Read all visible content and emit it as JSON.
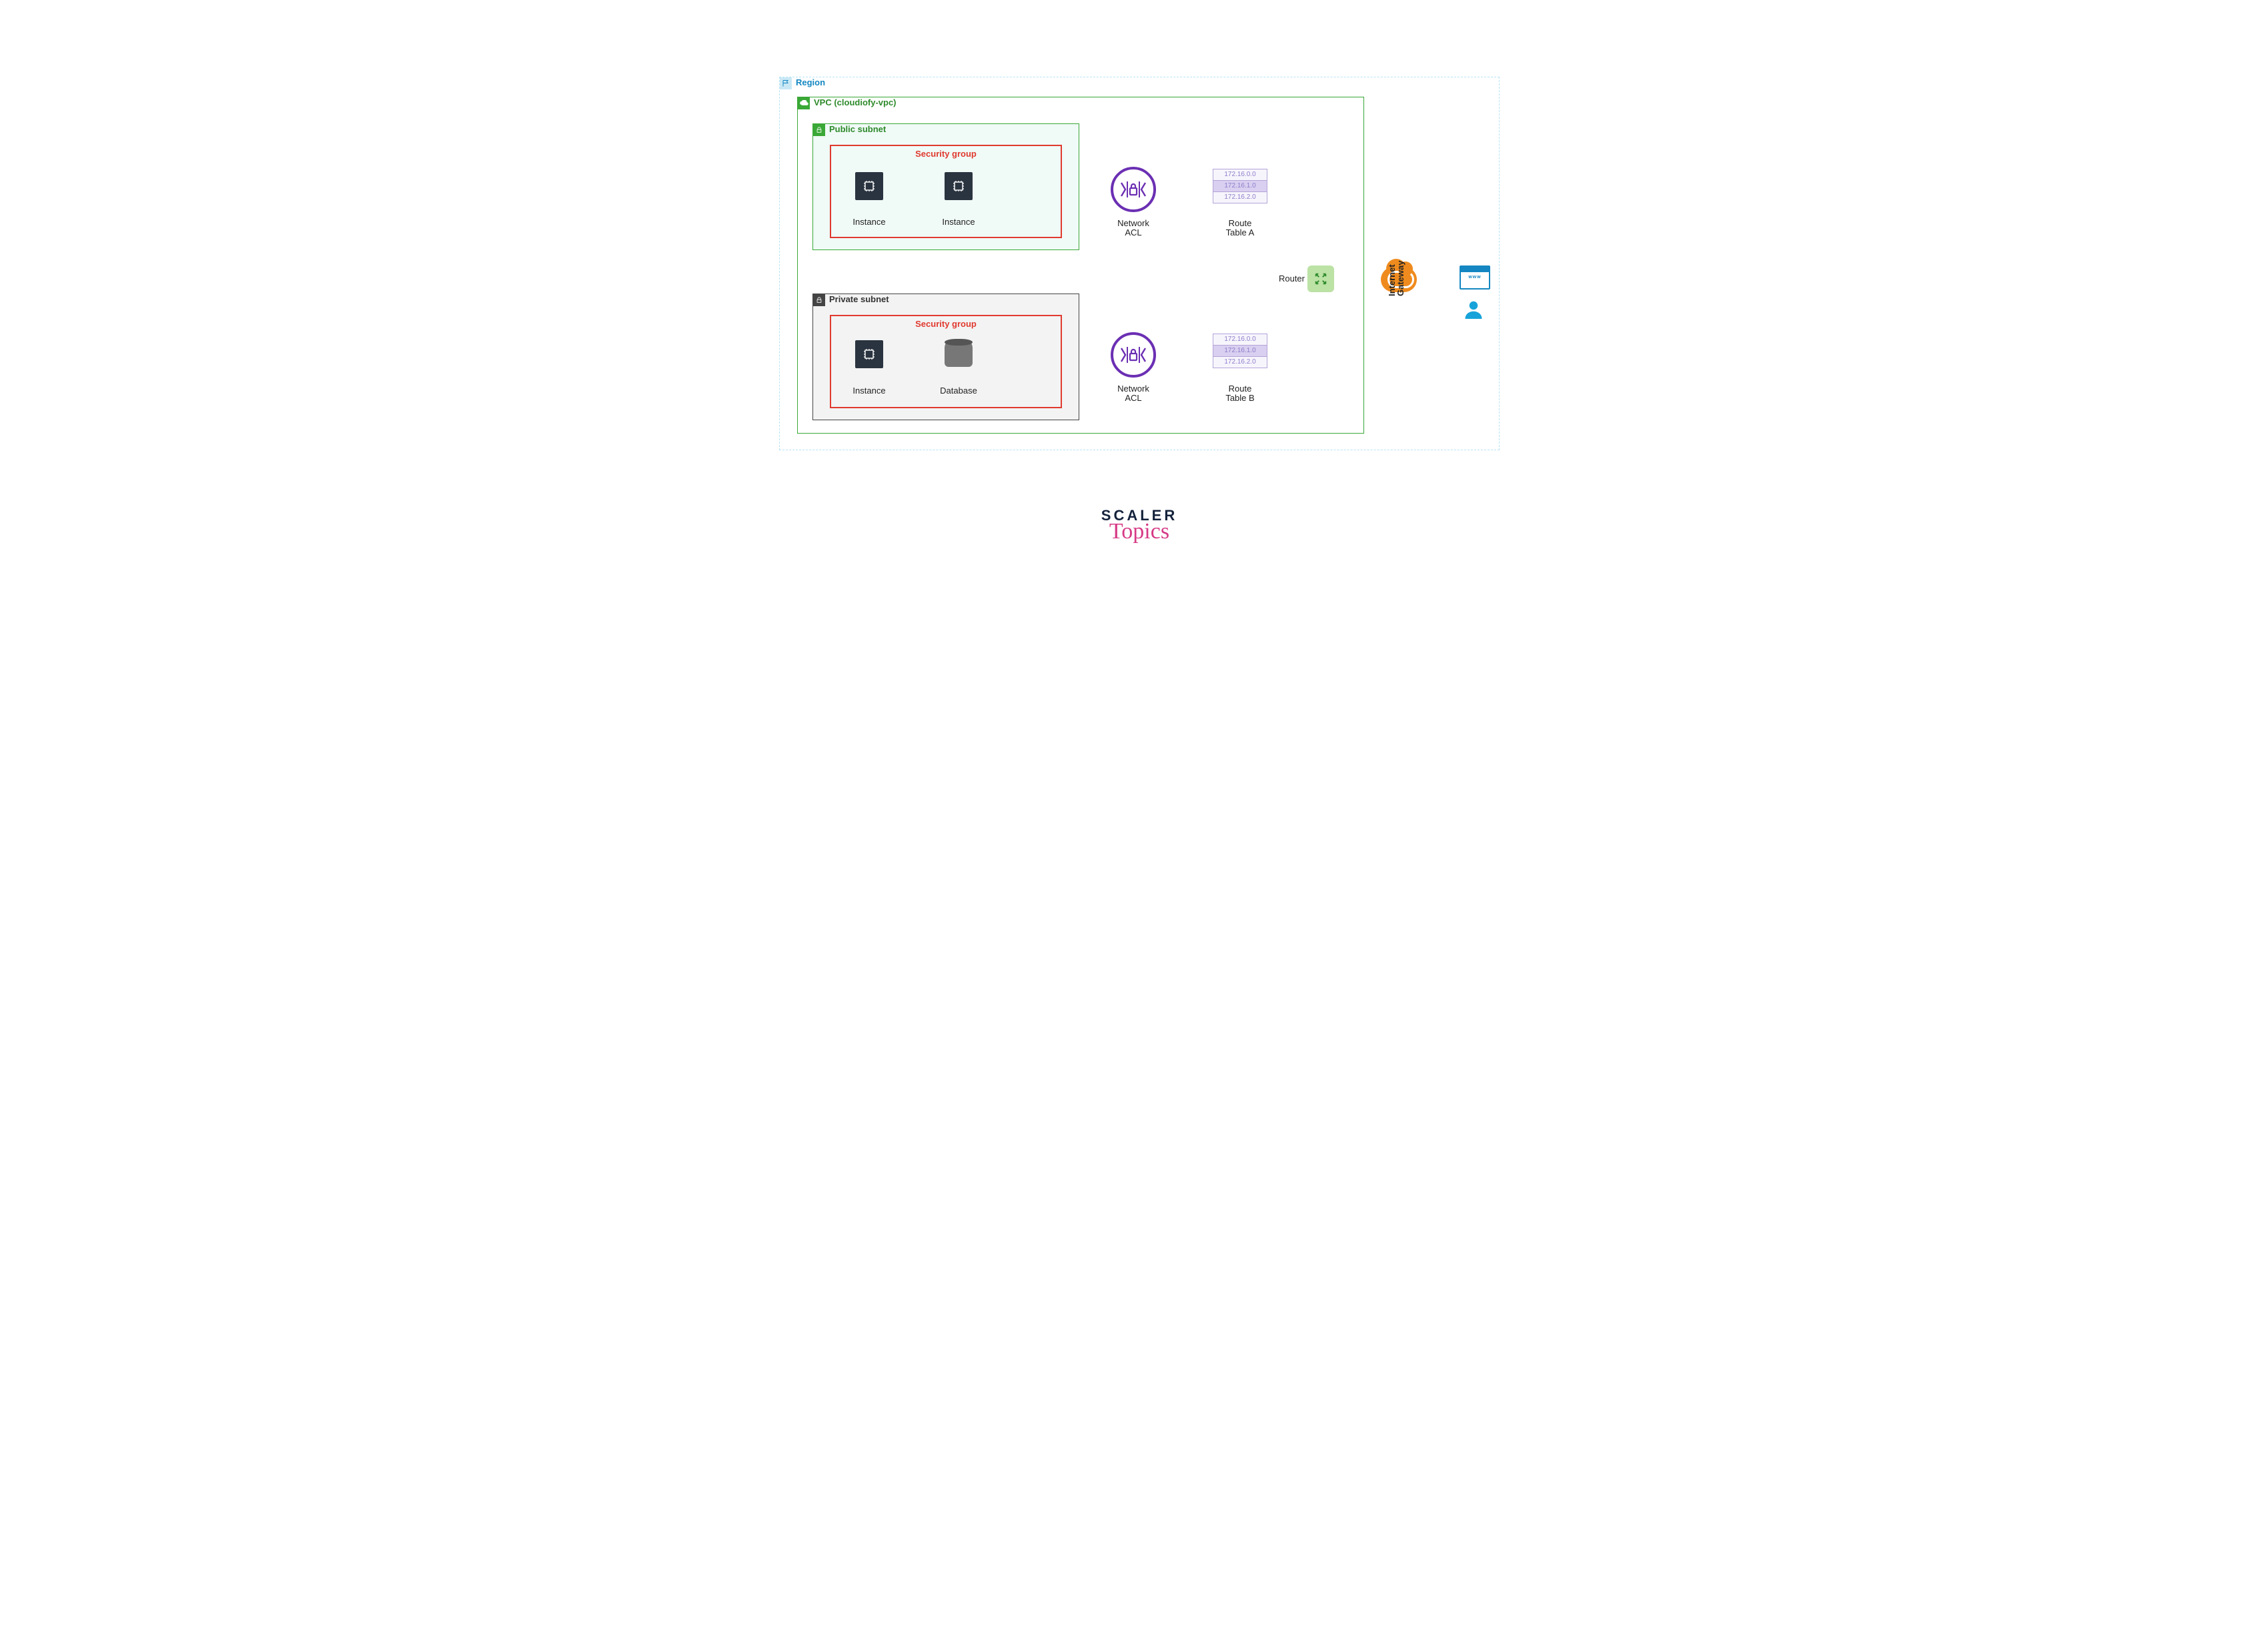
{
  "region": {
    "label": "Region"
  },
  "vpc": {
    "label": "VPC (cloudiofy-vpc)"
  },
  "public_subnet": {
    "label": "Public subnet",
    "security_group_label": "Security group",
    "items": [
      {
        "type": "instance",
        "label": "Instance"
      },
      {
        "type": "instance",
        "label": "Instance"
      }
    ]
  },
  "private_subnet": {
    "label": "Private subnet",
    "security_group_label": "Security group",
    "items": [
      {
        "type": "instance",
        "label": "Instance"
      },
      {
        "type": "database",
        "label": "Database"
      }
    ]
  },
  "nacl_top": {
    "label": "Network\nACL"
  },
  "nacl_bottom": {
    "label": "Network\nACL"
  },
  "route_table_a": {
    "label": "Route\nTable A",
    "rows": [
      "172.16.0.0",
      "172.16.1.0",
      "172.16.2.0"
    ]
  },
  "route_table_b": {
    "label": "Route\nTable B",
    "rows": [
      "172.16.0.0",
      "172.16.1.0",
      "172.16.2.0"
    ]
  },
  "router": {
    "label": "Router"
  },
  "igw": {
    "label": "Internet\nGateway"
  },
  "browser": {
    "label": "www"
  },
  "brand": {
    "line1": "SCALER",
    "line2": "Topics"
  }
}
